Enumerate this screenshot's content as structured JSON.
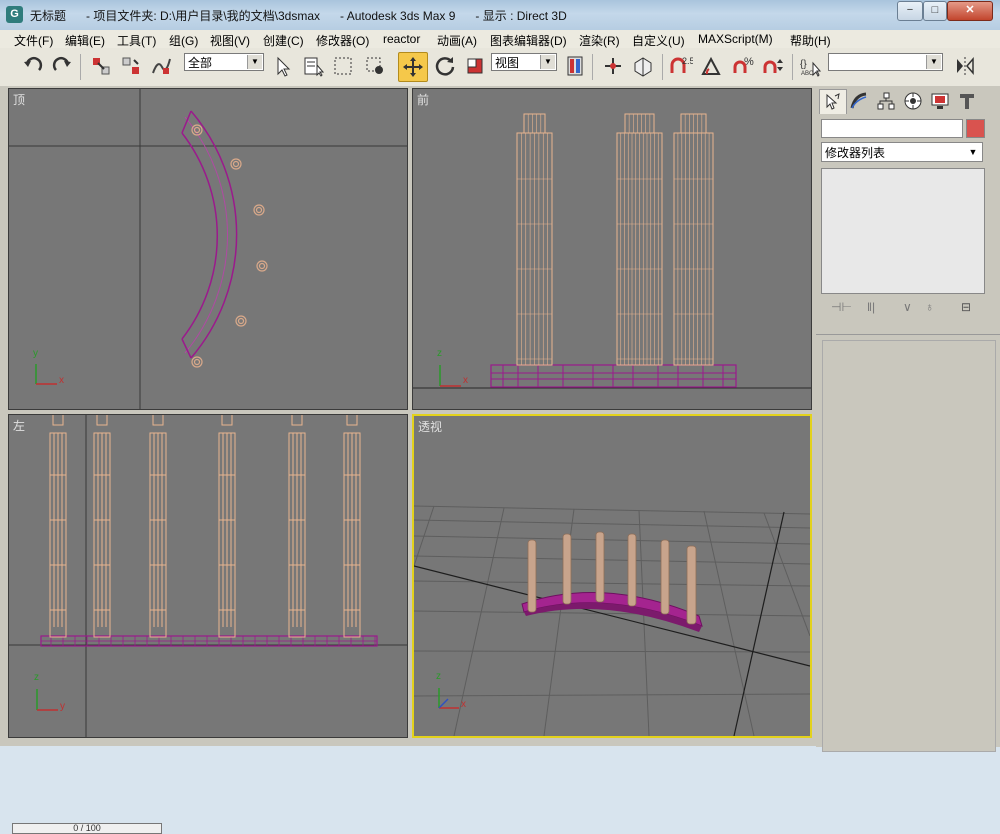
{
  "window": {
    "app_icon": "3ds-max-logo",
    "title": "无标题      - 项目文件夹: D:\\用户目录\\我的文档\\3dsmax      - Autodesk 3ds Max 9      - 显示 : Direct 3D",
    "minimize": "−",
    "maximize": "□",
    "close": "✕"
  },
  "menu": [
    "文件(F)",
    "编辑(E)",
    "工具(T)",
    "组(G)",
    "视图(V)",
    "创建(C)",
    "修改器(O)",
    "reactor",
    "动画(A)",
    "图表编辑器(D)",
    "渲染(R)",
    "自定义(U)",
    "MAXScript(M)",
    "帮助(H)"
  ],
  "toolbar": {
    "selection_filter": "全部",
    "coord_system": "视图",
    "named_selection": ""
  },
  "viewports": {
    "top": "顶",
    "front": "前",
    "left": "左",
    "perspective": "透视"
  },
  "axis_labels": {
    "x": "x",
    "y": "y",
    "z": "z"
  },
  "command_panel": {
    "object_name": "",
    "object_color": "#d9534f",
    "modifier_list": "修改器列表"
  },
  "timeline": {
    "frame": "0 / 100"
  }
}
